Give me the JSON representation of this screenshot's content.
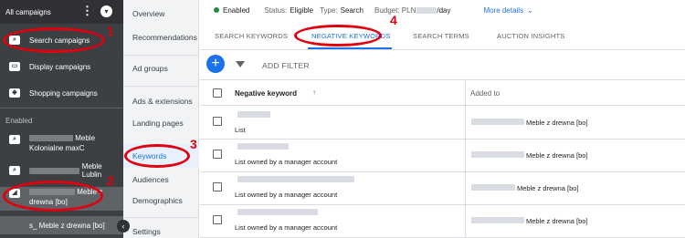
{
  "sidebar": {
    "title": "All campaigns",
    "items": [
      {
        "label": "Search campaigns"
      },
      {
        "label": "Display campaigns"
      },
      {
        "label": "Shopping campaigns"
      }
    ],
    "section_label": "Enabled",
    "campaigns": [
      {
        "suffix": "Meble",
        "line2": "Kolonialne maxC"
      },
      {
        "suffix": "Meble Lublin"
      },
      {
        "suffix": "Meble z",
        "line2": "drewna [bo]"
      }
    ],
    "ad_group": "s_ Meble z drewna [bo]"
  },
  "nav": {
    "items": [
      "Overview",
      "Recommendations",
      "Ad groups",
      "Ads & extensions",
      "Landing pages",
      "Keywords",
      "Audiences",
      "Demographics",
      "Settings"
    ]
  },
  "status": {
    "enabled": "Enabled",
    "status_label": "Status:",
    "status_value": "Eligible",
    "type_label": "Type:",
    "type_value": "Search",
    "budget_label": "Budget: PLN",
    "budget_suffix": "/day",
    "more_details": "More details"
  },
  "tabs": [
    "SEARCH KEYWORDS",
    "NEGATIVE KEYWORDS",
    "SEARCH TERMS",
    "AUCTION INSIGHTS"
  ],
  "filter": {
    "add_filter": "ADD FILTER"
  },
  "table": {
    "headers": [
      "Negative keyword",
      "Added to"
    ],
    "rows": [
      {
        "type": "List",
        "added_to": "Meble z drewna [bo]"
      },
      {
        "type": "List owned by a manager account",
        "added_to": "Meble z drewna [bo]"
      },
      {
        "type": "List owned by a manager account",
        "added_to": "Meble z drewna [bo]"
      },
      {
        "type": "List owned by a manager account",
        "added_to": "Meble z drewna [bo]"
      }
    ]
  },
  "annotations": [
    "1",
    "2",
    "3",
    "4"
  ],
  "colors": {
    "accent": "#1a73e8",
    "annotation": "#e0000f",
    "sidebar": "#3c4043",
    "enabled_dot": "#1e8e3e"
  }
}
